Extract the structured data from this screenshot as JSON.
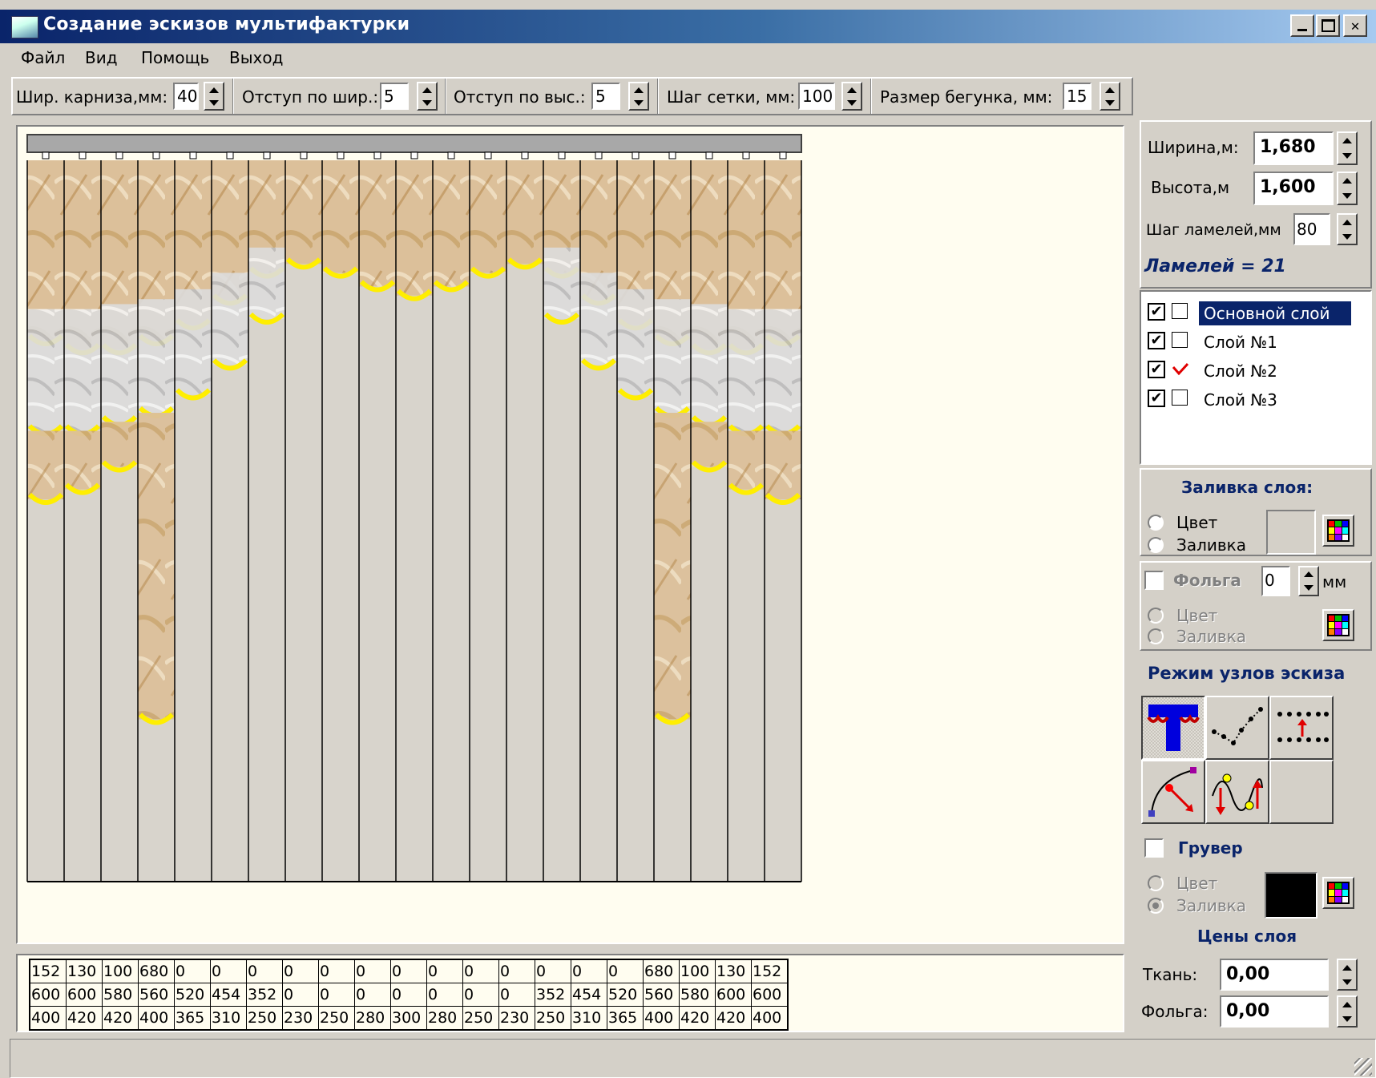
{
  "window": {
    "title": "Создание эскизов мультифактурки"
  },
  "menu": [
    "Файл",
    "Вид",
    "Помощь",
    "Выход"
  ],
  "toolbar": {
    "fields": [
      {
        "label": "Шир. карниза,мм:",
        "value": "40"
      },
      {
        "label": "Отступ по шир.:",
        "value": "5"
      },
      {
        "label": "Отступ по выс.:",
        "value": "5"
      },
      {
        "label": "Шаг сетки, мм:",
        "value": "100"
      },
      {
        "label": "Размер бегунка, мм:",
        "value": "15"
      }
    ]
  },
  "right_panel": {
    "width_label": "Ширина,м:",
    "width_value": "1,680",
    "height_label": "Высота,м",
    "height_value": "1,600",
    "step_label": "Шаг ламелей,мм",
    "step_value": "80",
    "count_text": "Ламелей = 21",
    "layers": [
      {
        "name": "Основной слой",
        "visible": true,
        "checked": false,
        "selected": true
      },
      {
        "name": "Слой №1",
        "visible": true,
        "checked": false,
        "selected": false
      },
      {
        "name": "Слой №2",
        "visible": true,
        "checked": true,
        "selected": false
      },
      {
        "name": "Слой №3",
        "visible": true,
        "checked": false,
        "selected": false
      }
    ],
    "fill_title": "Заливка слоя:",
    "fill_options": [
      "Цвет",
      "Заливка"
    ],
    "foil_label": "Фольга",
    "foil_value": "0",
    "foil_unit": "мм",
    "foil_options": [
      "Цвет",
      "Заливка"
    ],
    "mode_title": "Режим узлов эскиза",
    "mode_buttons": [
      "lambrequin-mode-icon",
      "polyline-nodes-icon",
      "grid-shift-icon",
      "bezier-curve-icon",
      "wave-nodes-icon",
      "empty-mode"
    ],
    "gruver_label": "Грувер",
    "gruver_options": [
      "Цвет",
      "Заливка"
    ],
    "gruver_color": "#000000",
    "prices_title": "Цены слоя",
    "fabric_label": "Ткань:",
    "fabric_value": "0,00",
    "foil_price_label": "Фольга:",
    "foil_price_value": "0,00"
  },
  "chart_data": {
    "type": "table",
    "slat_count": 21,
    "rows": [
      [
        "152",
        "130",
        "100",
        "680",
        "0",
        "0",
        "0",
        "0",
        "0",
        "0",
        "0",
        "0",
        "0",
        "0",
        "0",
        "0",
        "0",
        "680",
        "100",
        "130",
        "152"
      ],
      [
        "600",
        "600",
        "580",
        "560",
        "520",
        "454",
        "352",
        "0",
        "0",
        "0",
        "0",
        "0",
        "0",
        "0",
        "352",
        "454",
        "520",
        "560",
        "580",
        "600",
        "600"
      ],
      [
        "400",
        "420",
        "420",
        "400",
        "365",
        "310",
        "250",
        "230",
        "250",
        "280",
        "300",
        "280",
        "250",
        "230",
        "250",
        "310",
        "365",
        "400",
        "420",
        "420",
        "400"
      ]
    ]
  },
  "colors": {
    "title_bar_start": "#0a246a",
    "selection": "#0a246a",
    "accent_yellow": "#ffee00",
    "fabric": "#d9b98a",
    "slat_bg": "#d8d4cc"
  }
}
